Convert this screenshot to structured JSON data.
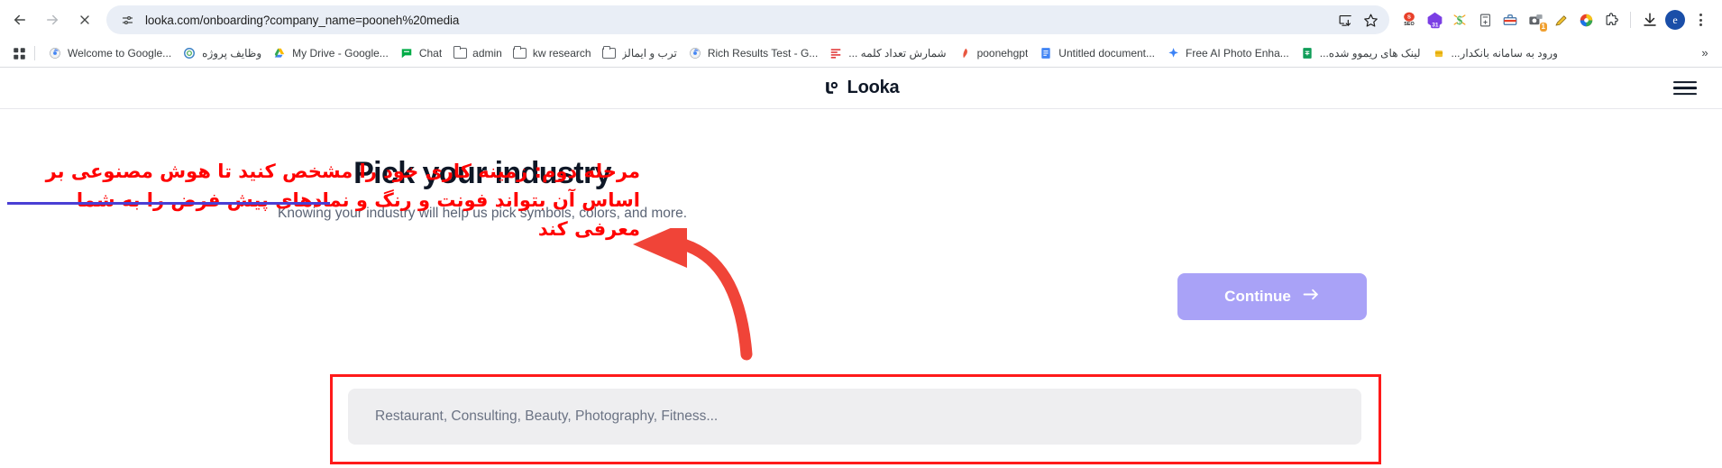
{
  "browser": {
    "nav": {
      "back_icon": "arrow-left-icon",
      "forward_icon": "arrow-right-icon",
      "stop_icon": "stop-loading-icon"
    },
    "omnibox": {
      "site_info_icon": "page-settings-icon",
      "url": "looka.com/onboarding?company_name=pooneh%20media",
      "install_icon": "install-app-icon",
      "bookmark_icon": "star-icon"
    },
    "extensions": [
      {
        "name": "seo-extension-icon",
        "glyph": "SEO"
      },
      {
        "name": "calendar-extension-icon",
        "glyph": "31"
      },
      {
        "name": "keywords-extension-icon",
        "glyph": "$"
      },
      {
        "name": "forms-extension-icon",
        "glyph": "+"
      },
      {
        "name": "toolbox-extension-icon",
        "glyph": ""
      },
      {
        "name": "screenshot-extension-icon",
        "glyph": "",
        "badge": "1"
      },
      {
        "name": "highlighter-extension-icon",
        "glyph": ""
      },
      {
        "name": "color-wheel-extension-icon",
        "glyph": ""
      },
      {
        "name": "extensions-puzzle-icon",
        "glyph": ""
      }
    ],
    "downloads_icon": "download-icon",
    "profile": {
      "name": "profile-avatar",
      "initial": "e"
    },
    "menu_icon": "kebab-menu-icon"
  },
  "bookmarks": {
    "apps_icon": "apps-grid-icon",
    "overflow_label": "»",
    "items": [
      {
        "label": "Welcome to Google...",
        "icon": "chrome-icon",
        "rtl": false
      },
      {
        "label": "وظایف پروژه",
        "icon": "site-icon",
        "rtl": true
      },
      {
        "label": "My Drive - Google...",
        "icon": "drive-icon",
        "rtl": false
      },
      {
        "label": "Chat",
        "icon": "chat-icon",
        "rtl": false
      },
      {
        "label": "admin",
        "icon": "folder-icon",
        "rtl": false
      },
      {
        "label": "kw research",
        "icon": "folder-icon",
        "rtl": false
      },
      {
        "label": "ترب و ایمالز",
        "icon": "folder-icon",
        "rtl": true
      },
      {
        "label": "Rich Results Test - G...",
        "icon": "chrome-icon",
        "rtl": false
      },
      {
        "label": "شمارش تعداد کلمه ...",
        "icon": "redlines-icon",
        "rtl": true
      },
      {
        "label": "poonehgpt",
        "icon": "feather-icon",
        "rtl": false
      },
      {
        "label": "Untitled document...",
        "icon": "docs-icon",
        "rtl": false
      },
      {
        "label": "Free AI Photo Enha...",
        "icon": "sparkle-icon",
        "rtl": false
      },
      {
        "label": "لینک های ریموو شده...",
        "icon": "sheets-icon",
        "rtl": true
      },
      {
        "label": "ورود به سامانه بانکدار...",
        "icon": "bank-icon",
        "rtl": true
      }
    ]
  },
  "site": {
    "brand_name": "Looka",
    "brand_mark": "looka-logo-icon",
    "menu_icon": "hamburger-menu-icon",
    "title": "Pick your industry",
    "subtitle": "Knowing your industry will help us pick symbols, colors, and more.",
    "continue_label": "Continue",
    "continue_arrow": "arrow-right-icon",
    "continue_color": "#a9a2f7",
    "search_placeholder": "Restaurant, Consulting, Beauty, Photography, Fitness..."
  },
  "annotation": {
    "color": "#ff0000",
    "underline_color": "#4a3fd4",
    "box_color": "#ff1a1a",
    "text": "مرحله دوم: زمینه کاری خود را مشخص کنید تا هوش مصنوعی بر اساس آن بتواند فونت و رنگ و نمادهای پیش فرض را به شما معرفی کند",
    "arrow_icon": "red-arrow-icon"
  }
}
